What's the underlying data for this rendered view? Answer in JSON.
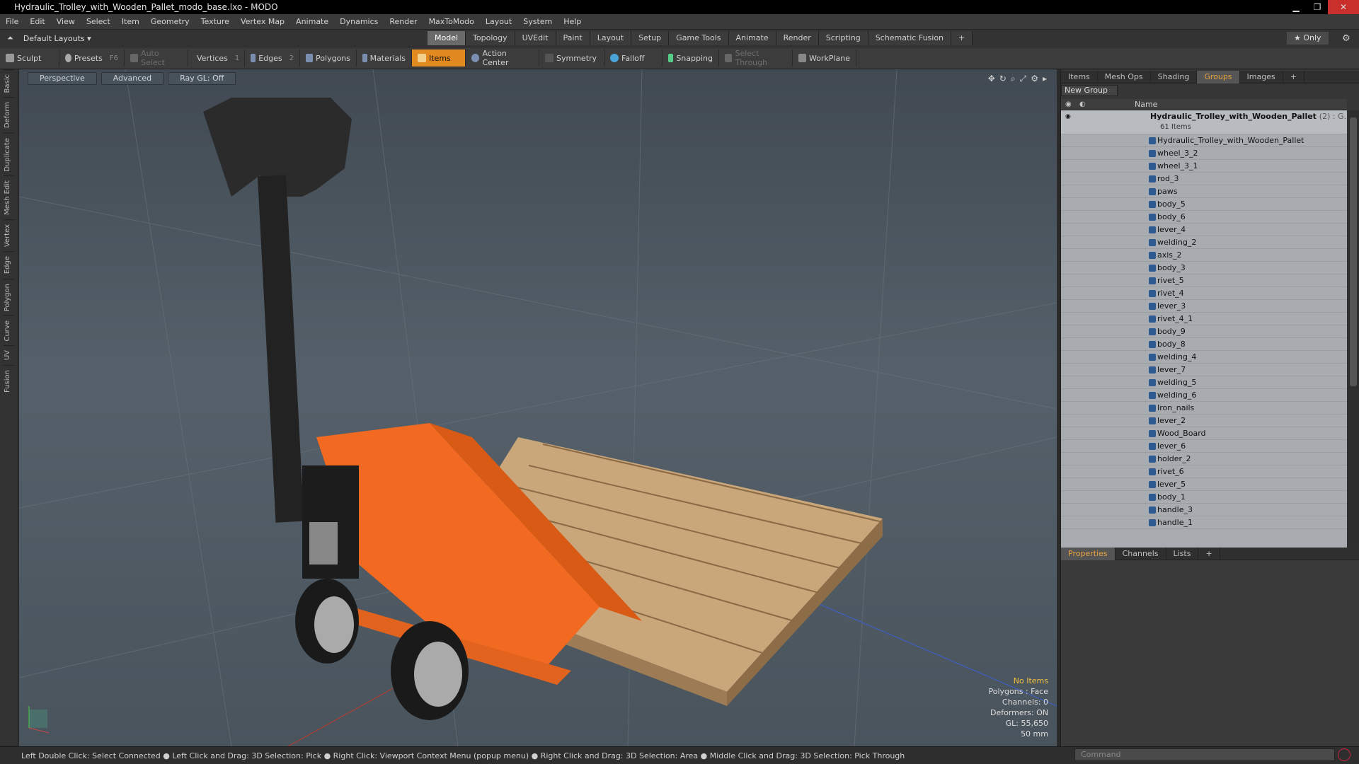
{
  "window": {
    "title": "Hydraulic_Trolley_with_Wooden_Pallet_modo_base.lxo - MODO",
    "min": "▁",
    "max": "❐",
    "close": "✕"
  },
  "menu": [
    "File",
    "Edit",
    "View",
    "Select",
    "Item",
    "Geometry",
    "Texture",
    "Vertex Map",
    "Animate",
    "Dynamics",
    "Render",
    "MaxToModo",
    "Layout",
    "System",
    "Help"
  ],
  "layouts": {
    "label": "Default Layouts ▾"
  },
  "tabs": [
    "Model",
    "Topology",
    "UVEdit",
    "Paint",
    "Layout",
    "Setup",
    "Game Tools",
    "Animate",
    "Render",
    "Scripting",
    "Schematic Fusion",
    "+"
  ],
  "right_top": {
    "only": "★ Only",
    "gear": "⚙"
  },
  "toolbar": {
    "sculpt": "Sculpt",
    "presets": "Presets",
    "presets_key": "F6",
    "auto_select": "Auto Select",
    "vertices": "Vertices",
    "vertices_key": "1",
    "edges": "Edges",
    "edges_key": "2",
    "polygons": "Polygons",
    "materials": "Materials",
    "items": "Items",
    "action_center": "Action Center",
    "symmetry": "Symmetry",
    "falloff": "Falloff",
    "snapping": "Snapping",
    "select_through": "Select Through",
    "workplane": "WorkPlane"
  },
  "left_tabs": [
    "Basic",
    "Deform",
    "Duplicate",
    "Mesh Edit",
    "Vertex",
    "Edge",
    "Polygon",
    "Curve",
    "UV",
    "Fusion"
  ],
  "viewport": {
    "perspective": "Perspective",
    "advanced": "Advanced",
    "raygl": "Ray GL: Off",
    "info": {
      "no_items": "No Items",
      "polygons": "Polygons : Face",
      "channels": "Channels: 0",
      "deformers": "Deformers: ON",
      "gl": "GL: 55,650",
      "scale": "50 mm"
    }
  },
  "status": {
    "hint": "Left Double Click: Select Connected ● Left Click and Drag: 3D Selection: Pick ● Right Click: Viewport Context Menu (popup menu) ● Right Click and Drag: 3D Selection: Area ● Middle Click and Drag: 3D Selection: Pick Through",
    "command": "Command"
  },
  "panel": {
    "tabs": [
      "Items",
      "Mesh Ops",
      "Shading",
      "Groups",
      "Images",
      "+"
    ],
    "new_group": "New Group",
    "name_col": "Name",
    "group": {
      "name": "Hydraulic_Trolley_with_Wooden_Pallet",
      "count": "(2) : G...",
      "sub": "61 Items"
    },
    "items": [
      "Hydraulic_Trolley_with_Wooden_Pallet",
      "wheel_3_2",
      "wheel_3_1",
      "rod_3",
      "paws",
      "body_5",
      "body_6",
      "lever_4",
      "welding_2",
      "axis_2",
      "body_3",
      "rivet_5",
      "rivet_4",
      "lever_3",
      "rivet_4_1",
      "body_9",
      "body_8",
      "welding_4",
      "lever_7",
      "welding_5",
      "welding_6",
      "Iron_nails",
      "lever_2",
      "Wood_Board",
      "lever_6",
      "holder_2",
      "rivet_6",
      "lever_5",
      "body_1",
      "handle_3",
      "handle_1"
    ],
    "bottom_tabs": [
      "Properties",
      "Channels",
      "Lists",
      "+"
    ]
  }
}
